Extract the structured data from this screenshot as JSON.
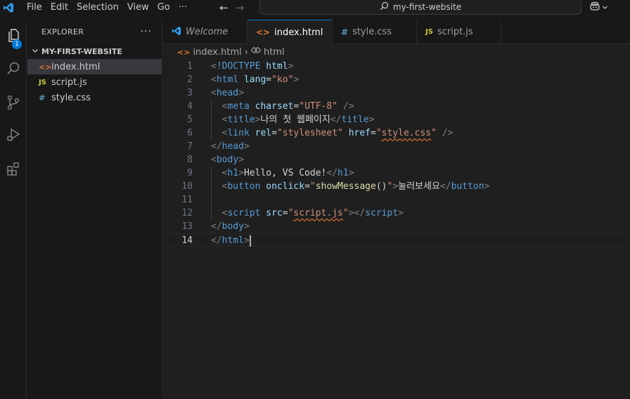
{
  "menu": [
    "File",
    "Edit",
    "Selection",
    "View",
    "Go",
    "···"
  ],
  "command_center": "my-first-website",
  "activity": {
    "explorer_badge": "1"
  },
  "sidebar": {
    "header": "EXPLORER",
    "more": "···",
    "folder": "MY-FIRST-WEBSITE",
    "files": [
      {
        "name": "index.html",
        "icon": "<>",
        "color": "#e37933"
      },
      {
        "name": "script.js",
        "icon": "JS",
        "color": "#cbcb41"
      },
      {
        "name": "style.css",
        "icon": "#",
        "color": "#519aba"
      }
    ]
  },
  "tabs": [
    {
      "label": "Welcome",
      "icon": "vscode-icon"
    },
    {
      "label": "index.html",
      "icon": "<>"
    },
    {
      "label": "style.css",
      "icon": "#"
    },
    {
      "label": "script.js",
      "icon": "JS"
    }
  ],
  "breadcrumb": {
    "file": "index.html",
    "sep": "›",
    "node": "html"
  },
  "editor": {
    "current_line": 14,
    "lines": [
      [
        [
          "p",
          "<"
        ],
        [
          "t",
          "!DOCTYPE"
        ],
        [
          "w",
          " "
        ],
        [
          "a",
          "html"
        ],
        [
          "p",
          ">"
        ]
      ],
      [
        [
          "p",
          "<"
        ],
        [
          "t",
          "html"
        ],
        [
          "w",
          " "
        ],
        [
          "a",
          "lang"
        ],
        [
          "w",
          "="
        ],
        [
          "s",
          "\"ko\""
        ],
        [
          "p",
          ">"
        ]
      ],
      [
        [
          "p",
          "<"
        ],
        [
          "t",
          "head"
        ],
        [
          "p",
          ">"
        ]
      ],
      [
        [
          "w",
          "  "
        ],
        [
          "p",
          "<"
        ],
        [
          "t",
          "meta"
        ],
        [
          "w",
          " "
        ],
        [
          "a",
          "charset"
        ],
        [
          "w",
          "="
        ],
        [
          "s",
          "\"UTF-8\""
        ],
        [
          "w",
          " "
        ],
        [
          "p",
          "/>"
        ]
      ],
      [
        [
          "w",
          "  "
        ],
        [
          "p",
          "<"
        ],
        [
          "t",
          "title"
        ],
        [
          "p",
          ">"
        ],
        [
          "w",
          "나의 첫 웹페이지"
        ],
        [
          "p",
          "</"
        ],
        [
          "t",
          "title"
        ],
        [
          "p",
          ">"
        ]
      ],
      [
        [
          "w",
          "  "
        ],
        [
          "p",
          "<"
        ],
        [
          "t",
          "link"
        ],
        [
          "w",
          " "
        ],
        [
          "a",
          "rel"
        ],
        [
          "w",
          "="
        ],
        [
          "s",
          "\"stylesheet\""
        ],
        [
          "w",
          " "
        ],
        [
          "a",
          "href"
        ],
        [
          "w",
          "="
        ],
        [
          "s",
          "\""
        ],
        [
          "su",
          "style.css"
        ],
        [
          "s",
          "\""
        ],
        [
          "w",
          " "
        ],
        [
          "p",
          "/>"
        ]
      ],
      [
        [
          "p",
          "</"
        ],
        [
          "t",
          "head"
        ],
        [
          "p",
          ">"
        ]
      ],
      [
        [
          "p",
          "<"
        ],
        [
          "t",
          "body"
        ],
        [
          "p",
          ">"
        ]
      ],
      [
        [
          "w",
          "  "
        ],
        [
          "p",
          "<"
        ],
        [
          "t",
          "h1"
        ],
        [
          "p",
          ">"
        ],
        [
          "w",
          "Hello, VS Code!"
        ],
        [
          "p",
          "</"
        ],
        [
          "t",
          "h1"
        ],
        [
          "p",
          ">"
        ]
      ],
      [
        [
          "w",
          "  "
        ],
        [
          "p",
          "<"
        ],
        [
          "t",
          "button"
        ],
        [
          "w",
          " "
        ],
        [
          "a",
          "onclick"
        ],
        [
          "w",
          "="
        ],
        [
          "s",
          "\""
        ],
        [
          "f",
          "showMessage"
        ],
        [
          "w",
          "()"
        ],
        [
          "s",
          "\""
        ],
        [
          "p",
          ">"
        ],
        [
          "w",
          "눌러보세요"
        ],
        [
          "p",
          "</"
        ],
        [
          "t",
          "button"
        ],
        [
          "p",
          ">"
        ]
      ],
      [],
      [
        [
          "w",
          "  "
        ],
        [
          "p",
          "<"
        ],
        [
          "t",
          "script"
        ],
        [
          "w",
          " "
        ],
        [
          "a",
          "src"
        ],
        [
          "w",
          "="
        ],
        [
          "s",
          "\""
        ],
        [
          "su",
          "script.js"
        ],
        [
          "s",
          "\""
        ],
        [
          "p",
          "></"
        ],
        [
          "t",
          "script"
        ],
        [
          "p",
          ">"
        ]
      ],
      [
        [
          "p",
          "</"
        ],
        [
          "t",
          "body"
        ],
        [
          "p",
          ">"
        ]
      ],
      [
        [
          "p",
          "</"
        ],
        [
          "t",
          "html"
        ],
        [
          "p",
          ">"
        ]
      ]
    ]
  },
  "colors": {
    "accent": "#0078d4",
    "tag": "#569cd6",
    "attr": "#9cdcfe",
    "string": "#ce9178",
    "function": "#dcdcaa"
  }
}
